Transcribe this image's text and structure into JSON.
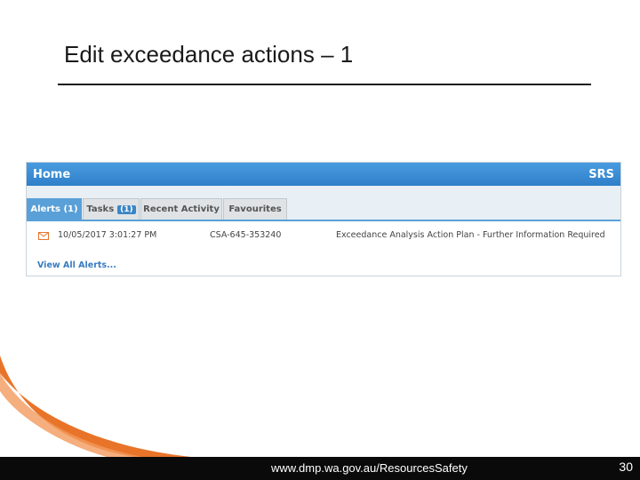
{
  "slide": {
    "title": "Edit exceedance actions – 1"
  },
  "panel": {
    "header_title": "Home",
    "header_brand": "SRS",
    "tabs": [
      {
        "label": "Alerts (1)",
        "active": true
      },
      {
        "label": "Tasks",
        "badge": "(1)",
        "active": false
      },
      {
        "label": "Recent Activity",
        "active": false
      },
      {
        "label": "Favourites",
        "active": false
      }
    ],
    "alert": {
      "icon": "mail-icon",
      "datetime": "10/05/2017 3:01:27 PM",
      "reference": "CSA-645-353240",
      "description": "Exceedance Analysis Action Plan - Further Information Required"
    },
    "view_all_label": "View All Alerts..."
  },
  "footer": {
    "url": "www.dmp.wa.gov.au/ResourcesSafety",
    "page_number": "30"
  },
  "colors": {
    "header_blue": "#2e7fc8",
    "tab_active": "#5aa0d8",
    "link_blue": "#3a7cc0",
    "accent_orange": "#e8742a",
    "footer_bg": "#0a0a0a"
  }
}
